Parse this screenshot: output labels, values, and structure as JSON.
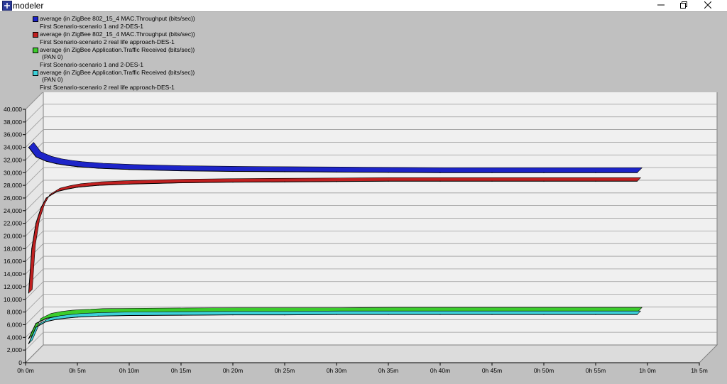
{
  "window": {
    "title": "modeler",
    "minimize_icon": "minimize-icon",
    "maximize_icon": "restore-icon",
    "close_icon": "close-icon"
  },
  "colors": {
    "legend_bg": "#c0c0c0",
    "plot_floor": "#f0f0f0",
    "series_blue": "#1d24c8",
    "series_red": "#c02020",
    "series_green": "#3ccd2c",
    "series_cyan": "#3cd0d8"
  },
  "legend": [
    {
      "label": "average (in ZigBee 802_15_4 MAC.Throughput (bits/sec))",
      "sub": [
        "First Scenario-scenario 1 and 2-DES-1"
      ]
    },
    {
      "label": "average (in ZigBee 802_15_4 MAC.Throughput (bits/sec))",
      "sub": [
        "First Scenario-scenario 2 real life approach-DES-1"
      ]
    },
    {
      "label": "average (in ZigBee Application.Traffic Received (bits/sec))",
      "sub": [
        "(PAN 0)",
        "First Scenario-scenario 1 and 2-DES-1"
      ]
    },
    {
      "label": "average (in ZigBee Application.Traffic Received (bits/sec))",
      "sub": [
        "(PAN 0)",
        "First Scenario-scenario 2 real life approach-DES-1"
      ]
    }
  ],
  "chart_data": {
    "type": "line",
    "title": "",
    "xlabel": "",
    "ylabel": "",
    "style": "3d-ribbon",
    "grid": true,
    "legend_position": "top",
    "x_tick_labels": [
      "0h 0m",
      "0h 5m",
      "0h 10m",
      "0h 15m",
      "0h 20m",
      "0h 25m",
      "0h 30m",
      "0h 35m",
      "0h 40m",
      "0h 45m",
      "0h 50m",
      "0h 55m",
      "1h 0m",
      "1h 5m"
    ],
    "y_tick_labels": [
      "0",
      "2,000",
      "4,000",
      "6,000",
      "8,000",
      "10,000",
      "12,000",
      "14,000",
      "16,000",
      "18,000",
      "20,000",
      "22,000",
      "24,000",
      "26,000",
      "28,000",
      "30,000",
      "32,000",
      "34,000",
      "36,000",
      "38,000",
      "40,000"
    ],
    "xlim_minutes": [
      0,
      65
    ],
    "ylim": [
      0,
      40000
    ],
    "series": [
      {
        "color": "#1d24c8",
        "x": [
          0.3,
          1,
          2,
          3,
          4,
          5,
          7,
          10,
          15,
          20,
          25,
          30,
          35,
          40,
          45,
          50,
          55,
          59
        ],
        "y": [
          34000,
          32500,
          31800,
          31400,
          31150,
          30950,
          30700,
          30500,
          30300,
          30200,
          30150,
          30100,
          30050,
          30000,
          30000,
          30000,
          30000,
          30000
        ]
      },
      {
        "color": "#c02020",
        "x": [
          0.3,
          0.6,
          1,
          1.5,
          2,
          3,
          4,
          5,
          7,
          10,
          15,
          20,
          25,
          30,
          35,
          40,
          45,
          50,
          55,
          59
        ],
        "y": [
          11000,
          18000,
          22000,
          24500,
          26000,
          27000,
          27400,
          27700,
          28000,
          28200,
          28400,
          28500,
          28550,
          28600,
          28650,
          28650,
          28650,
          28650,
          28650,
          28650
        ]
      },
      {
        "color": "#3ccd2c",
        "x": [
          0.3,
          1,
          2,
          3,
          4,
          5,
          7,
          10,
          15,
          20,
          25,
          30,
          35,
          40,
          45,
          50,
          55,
          59
        ],
        "y": [
          3800,
          6200,
          7000,
          7300,
          7500,
          7600,
          7750,
          7800,
          7850,
          7900,
          7900,
          7900,
          7950,
          7950,
          7950,
          7950,
          7950,
          7950
        ]
      },
      {
        "color": "#3cd0d8",
        "x": [
          0.3,
          1,
          2,
          3,
          4,
          5,
          7,
          10,
          15,
          20,
          25,
          30,
          35,
          40,
          45,
          50,
          55,
          59
        ],
        "y": [
          3000,
          5600,
          6500,
          6850,
          7050,
          7200,
          7350,
          7450,
          7500,
          7550,
          7550,
          7600,
          7600,
          7600,
          7600,
          7600,
          7600,
          7600
        ]
      }
    ]
  }
}
